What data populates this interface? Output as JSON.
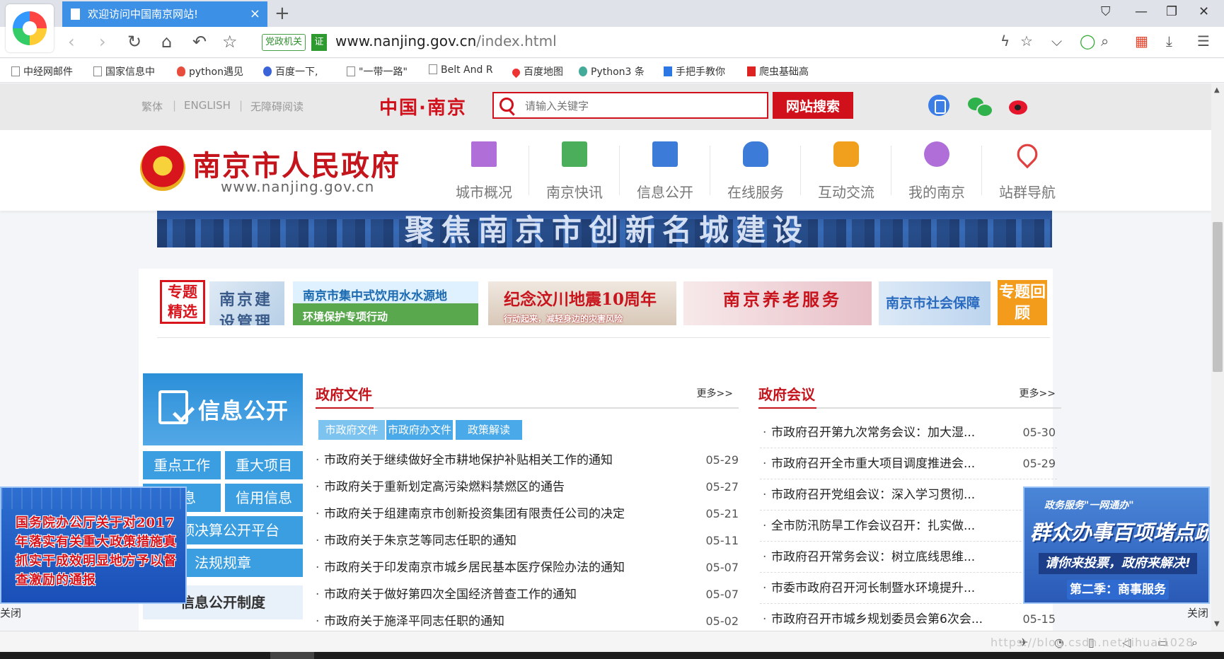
{
  "browser": {
    "tab_title": "欢迎访问中国南京网站!",
    "tab_close": "×",
    "new_tab": "+",
    "window_controls": [
      "⛉",
      "—",
      "❐",
      "✕"
    ],
    "nav": {
      "back": "‹",
      "forward": "›",
      "reload": "↻",
      "home": "⌂",
      "undo": "↶",
      "star": "☆"
    },
    "address": {
      "party_badge": "党政机关",
      "cert_badge": "证",
      "host": "www.nanjing.gov.cn",
      "path": "/index.html"
    },
    "address_right": [
      "ϟ",
      "☆",
      "⌵",
      "◯",
      "⌕",
      "▦",
      "⤓",
      "☰"
    ],
    "bookmarks": [
      "中经网邮件",
      "国家信息中",
      "python遇见",
      "百度一下,",
      "\"一带一路\"",
      "Belt And R",
      "百度地图",
      "Python3 条",
      "手把手教你",
      "爬虫基础高"
    ]
  },
  "topbar": {
    "lang_links": [
      "繁体",
      "ENGLISH",
      "无障碍阅读"
    ],
    "separator": "|",
    "brand": "中国·南京",
    "search_placeholder": "请输入关键字",
    "search_button": "网站搜索"
  },
  "header": {
    "site_name": "南京市人民政府",
    "site_url": "www.nanjing.gov.cn",
    "nav": [
      {
        "label": "城市概况",
        "icon": "building-icon"
      },
      {
        "label": "南京快讯",
        "icon": "newspaper-icon"
      },
      {
        "label": "信息公开",
        "icon": "document-icon"
      },
      {
        "label": "在线服务",
        "icon": "thumb-up-icon"
      },
      {
        "label": "互动交流",
        "icon": "chat-icon"
      },
      {
        "label": "我的南京",
        "icon": "flower-icon"
      },
      {
        "label": "站群导航",
        "icon": "location-icon"
      }
    ]
  },
  "banner": {
    "slogan": "聚焦南京市创新名城建设"
  },
  "topics": {
    "tag": "专题精选",
    "items": [
      {
        "title": "南京建设管理",
        "sub": ""
      },
      {
        "title": "南京市集中式饮用水水源地",
        "sub": "环境保护专项行动"
      },
      {
        "title": "纪念汶川地震10周年",
        "sub": "行动起来，减轻身边的灾害风险"
      },
      {
        "title": "南京养老服务",
        "sub": ""
      },
      {
        "title": "南京市社会保障",
        "sub": ""
      }
    ],
    "review": "专题回顾"
  },
  "info_panel": {
    "title": "信息公开",
    "buttons": [
      "重点工作",
      "重大项目",
      "信息",
      "信用信息"
    ],
    "wide": [
      "市预决算公开平台",
      "法规规章"
    ],
    "system": "信息公开制度"
  },
  "gov_docs": {
    "title": "政府文件",
    "more": "更多>>",
    "tabs": [
      "市政府文件",
      "市政府办文件",
      "政策解读"
    ],
    "items": [
      {
        "text": "市政府关于继续做好全市耕地保护补贴相关工作的通知",
        "date": "05-29"
      },
      {
        "text": "市政府关于重新划定高污染燃料禁燃区的通告",
        "date": "05-27"
      },
      {
        "text": "市政府关于组建南京市创新投资集团有限责任公司的决定",
        "date": "05-21"
      },
      {
        "text": "市政府关于朱京芝等同志任职的通知",
        "date": "05-11"
      },
      {
        "text": "市政府关于印发南京市城乡居民基本医疗保险办法的通知",
        "date": "05-07"
      },
      {
        "text": "市政府关于做好第四次全国经济普查工作的通知",
        "date": "05-07"
      },
      {
        "text": "市政府关于施泽平同志任职的通知",
        "date": "05-02"
      }
    ]
  },
  "gov_meetings": {
    "title": "政府会议",
    "more": "更多>>",
    "items": [
      {
        "text": "市政府召开第九次常务会议：加大湿...",
        "date": "05-30"
      },
      {
        "text": "市政府召开全市重大项目调度推进会...",
        "date": "05-29"
      },
      {
        "text": "市政府召开党组会议：深入学习贯彻...",
        "date": ""
      },
      {
        "text": "全市防汛防旱工作会议召开：扎实做...",
        "date": ""
      },
      {
        "text": "市政府召开常务会议：树立底线思维...",
        "date": ""
      },
      {
        "text": "市委市政府召开河长制暨水环境提升...",
        "date": ""
      },
      {
        "text": "市政府召开市城乡规划委员会第6次会...",
        "date": "05-15"
      }
    ]
  },
  "float_left": {
    "text": "国务院办公厅关于对2017年落实有关重大政策措施真抓实干成效明显地方予以督查激励的通报",
    "close": "关闭"
  },
  "float_right": {
    "line1": "政务服务\"一网通办\"",
    "line2": "群众办事百项堵点疏解行动",
    "line3": "请你来投票，政府来解决!",
    "line4": "第二季：商事服务",
    "close": "关闭"
  },
  "statusbar": {
    "watermark": "https://blog.csdn.net/lihuai1028"
  }
}
